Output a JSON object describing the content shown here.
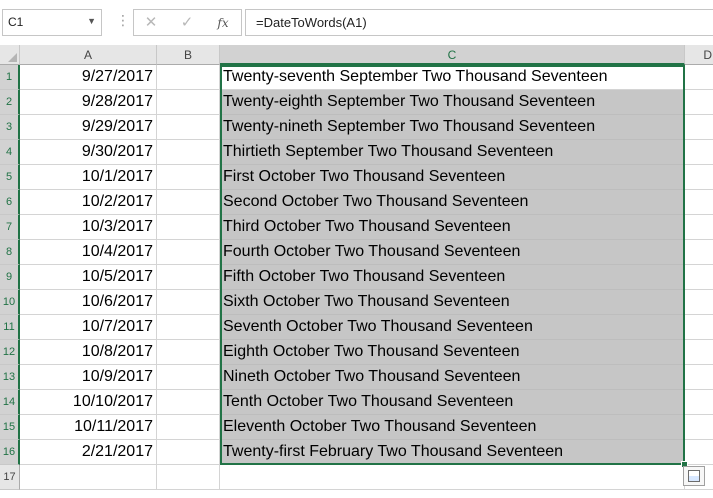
{
  "namebox": {
    "value": "C1"
  },
  "formula_bar": {
    "cancel_glyph": "✕",
    "enter_glyph": "✓",
    "fx_label": "fx",
    "formula": "=DateToWords(A1)"
  },
  "columns": [
    "A",
    "B",
    "C",
    "D"
  ],
  "rows": [
    {
      "num": "1",
      "a": "9/27/2017",
      "c": "Twenty-seventh September Two Thousand Seventeen"
    },
    {
      "num": "2",
      "a": "9/28/2017",
      "c": "Twenty-eighth September Two Thousand Seventeen"
    },
    {
      "num": "3",
      "a": "9/29/2017",
      "c": "Twenty-nineth September Two Thousand Seventeen"
    },
    {
      "num": "4",
      "a": "9/30/2017",
      "c": "Thirtieth September Two Thousand Seventeen"
    },
    {
      "num": "5",
      "a": "10/1/2017",
      "c": "First October Two Thousand Seventeen"
    },
    {
      "num": "6",
      "a": "10/2/2017",
      "c": "Second October Two Thousand Seventeen"
    },
    {
      "num": "7",
      "a": "10/3/2017",
      "c": "Third October Two Thousand Seventeen"
    },
    {
      "num": "8",
      "a": "10/4/2017",
      "c": "Fourth October Two Thousand Seventeen"
    },
    {
      "num": "9",
      "a": "10/5/2017",
      "c": "Fifth October Two Thousand Seventeen"
    },
    {
      "num": "10",
      "a": "10/6/2017",
      "c": "Sixth October Two Thousand Seventeen"
    },
    {
      "num": "11",
      "a": "10/7/2017",
      "c": "Seventh October Two Thousand Seventeen"
    },
    {
      "num": "12",
      "a": "10/8/2017",
      "c": "Eighth October Two Thousand Seventeen"
    },
    {
      "num": "13",
      "a": "10/9/2017",
      "c": "Nineth October Two Thousand Seventeen"
    },
    {
      "num": "14",
      "a": "10/10/2017",
      "c": "Tenth October Two Thousand Seventeen"
    },
    {
      "num": "15",
      "a": "10/11/2017",
      "c": "Eleventh October Two Thousand Seventeen"
    },
    {
      "num": "16",
      "a": "2/21/2017",
      "c": "Twenty-first February Two Thousand Seventeen"
    },
    {
      "num": "17",
      "a": "",
      "c": ""
    }
  ],
  "colors": {
    "accent": "#217346",
    "selection_fill": "#c6c6c6"
  }
}
